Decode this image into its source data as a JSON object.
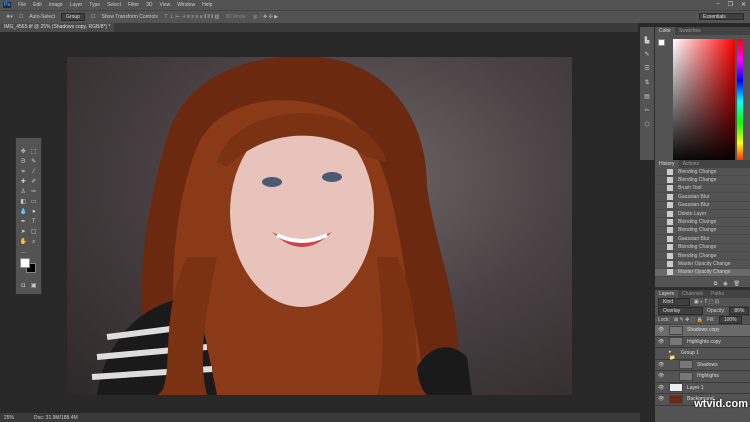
{
  "menu": [
    "File",
    "Edit",
    "Image",
    "Layer",
    "Type",
    "Select",
    "Filter",
    "3D",
    "View",
    "Window",
    "Help"
  ],
  "app_logo": "Ps",
  "options": {
    "auto_select": "Auto-Select",
    "group": "Group",
    "show_transform": "Show Transform Controls",
    "mode_3d": "3D Mode:",
    "workspace": "Essentials"
  },
  "document_tab": "IMG_4565.tif @ 25% (Shadows copy, RGB/8*) *",
  "status": {
    "zoom": "25%",
    "doc": "Doc: 31.9M/188.4M"
  },
  "color_panel": {
    "tabs": [
      "Color",
      "Swatches"
    ]
  },
  "history": {
    "tabs": [
      "History",
      "Actions"
    ],
    "items": [
      "Blending Change",
      "Blending Change",
      "Brush Tool",
      "Gaussian Blur",
      "Gaussian Blur",
      "Delete Layer",
      "Blending Change",
      "Blending Change",
      "Gaussian Blur",
      "Blending Change",
      "Blending Change",
      "Master Opacity Change",
      "Master Opacity Change"
    ]
  },
  "layers": {
    "tabs": [
      "Layers",
      "Channels",
      "Paths"
    ],
    "filter": "Kind",
    "blend_mode": "Overlay",
    "opacity_label": "Opacity:",
    "opacity": "86%",
    "lock_label": "Lock:",
    "fill_label": "Fill:",
    "fill": "100%",
    "items": [
      {
        "name": "Shadows copy",
        "selected": true
      },
      {
        "name": "Highlights copy"
      },
      {
        "name": "Group 1"
      },
      {
        "name": "Shadows"
      },
      {
        "name": "Highlights"
      },
      {
        "name": "Layer 1"
      },
      {
        "name": "Background"
      }
    ]
  },
  "watermark": "wtvid.com"
}
